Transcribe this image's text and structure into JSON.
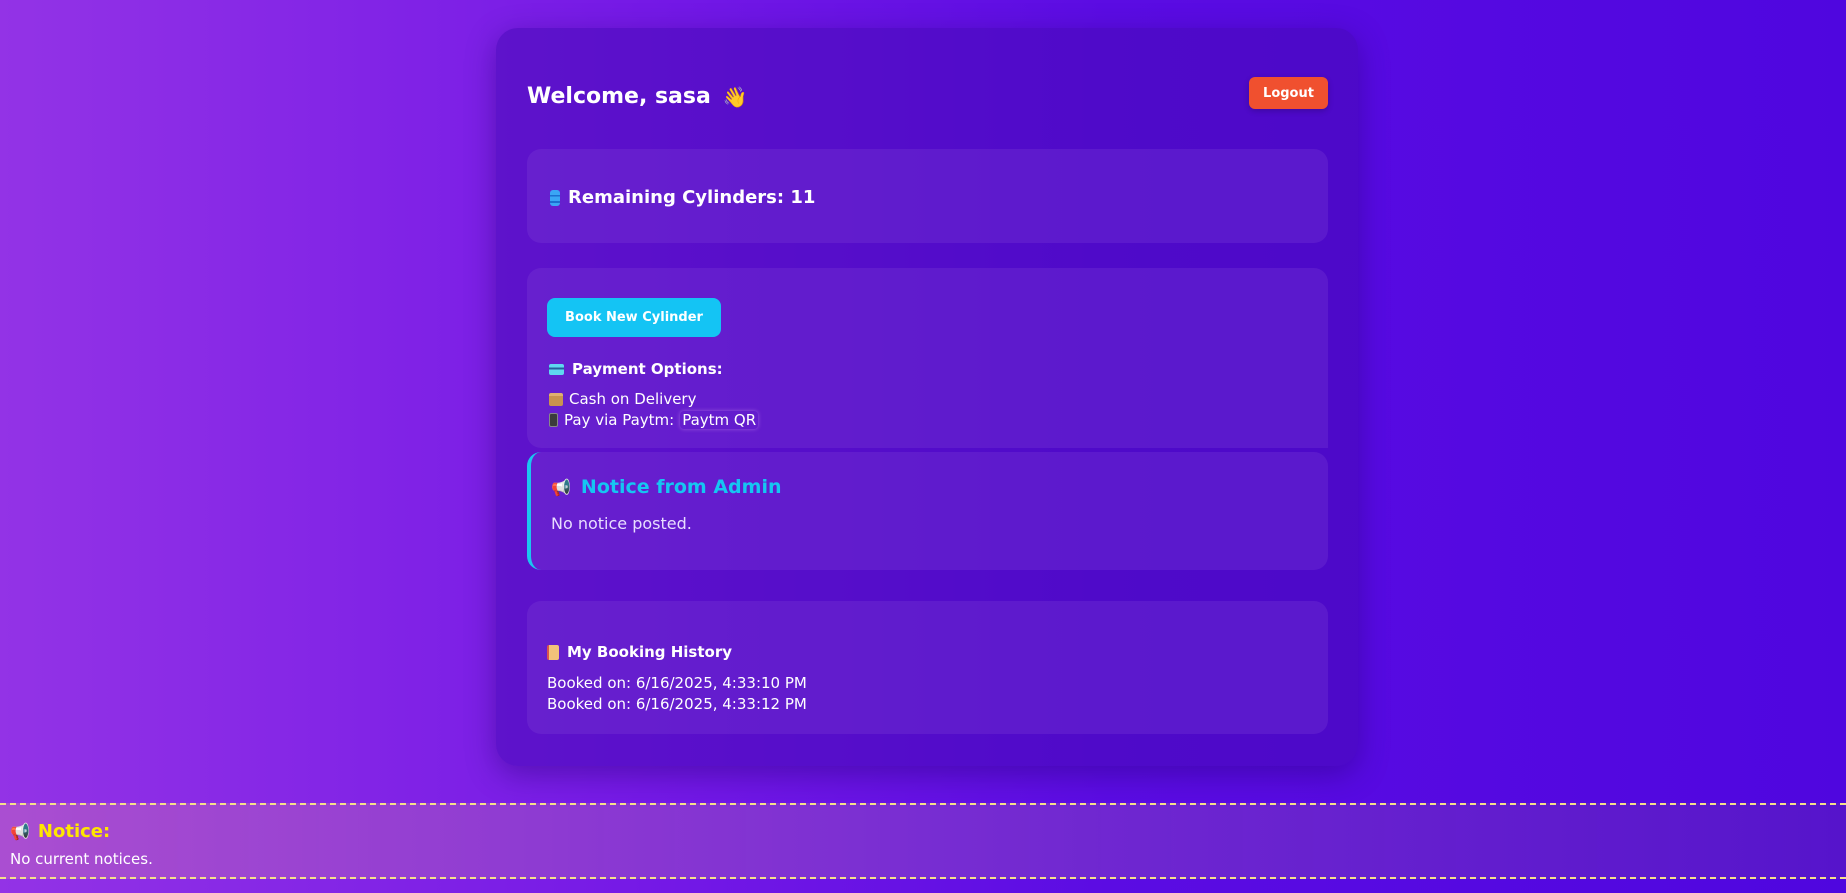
{
  "header": {
    "welcome": "Welcome, sasa",
    "wave_emoji": "👋",
    "logout_label": "Logout"
  },
  "stock": {
    "icon": "cylinder-icon",
    "remaining_text": "Remaining Cylinders: 11"
  },
  "booking": {
    "book_button_label": "Book New Cylinder",
    "payment_title": "Payment Options:",
    "options": [
      {
        "icon": "package-icon",
        "text": "Cash on Delivery"
      },
      {
        "icon": "phone-icon",
        "prefix": "Pay via Paytm:",
        "link_text": "Paytm QR"
      }
    ]
  },
  "admin_notice": {
    "icon": "megaphone-icon",
    "emoji": "📢",
    "title": "Notice from Admin",
    "text": "No notice posted."
  },
  "history": {
    "icon": "scroll-icon",
    "title": "My Booking History",
    "rows": [
      "Booked on: 6/16/2025, 4:33:10 PM",
      "Booked on: 6/16/2025, 4:33:12 PM"
    ]
  },
  "footer_notice": {
    "emoji": "📢",
    "title": "Notice:",
    "text": "No current notices."
  },
  "colors": {
    "accent_cyan": "#14c4f4",
    "logout_red": "#f0502f",
    "notice_yellow": "#ffe600"
  }
}
